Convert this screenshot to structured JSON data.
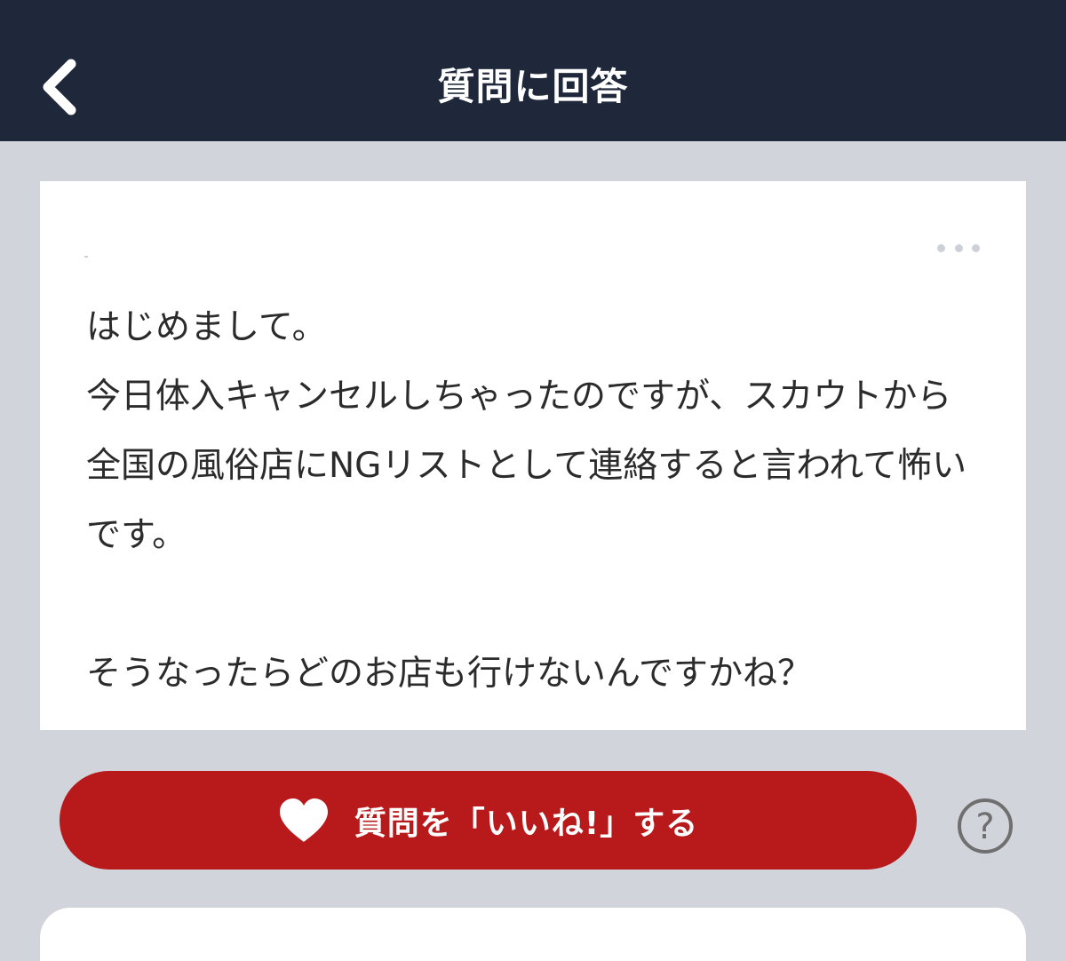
{
  "header": {
    "title": "質問に回答",
    "back_icon": "chevron-left-icon"
  },
  "question": {
    "more_icon": "more-horizontal-icon",
    "body": "はじめまして。\n今日体入キャンセルしちゃったのですが、スカウトから全国の風俗店にNGリストとして連絡すると言われて怖いです。\n\nそうなったらどのお店も行けないんですかね？"
  },
  "like_button": {
    "icon": "heart-icon",
    "label": "質問を「いいね!」する"
  },
  "help_button": {
    "icon": "question-circle-icon",
    "label": "?"
  },
  "colors": {
    "header_bg": "#1e283a",
    "page_bg": "#d1d4da",
    "accent": "#b8191b"
  }
}
